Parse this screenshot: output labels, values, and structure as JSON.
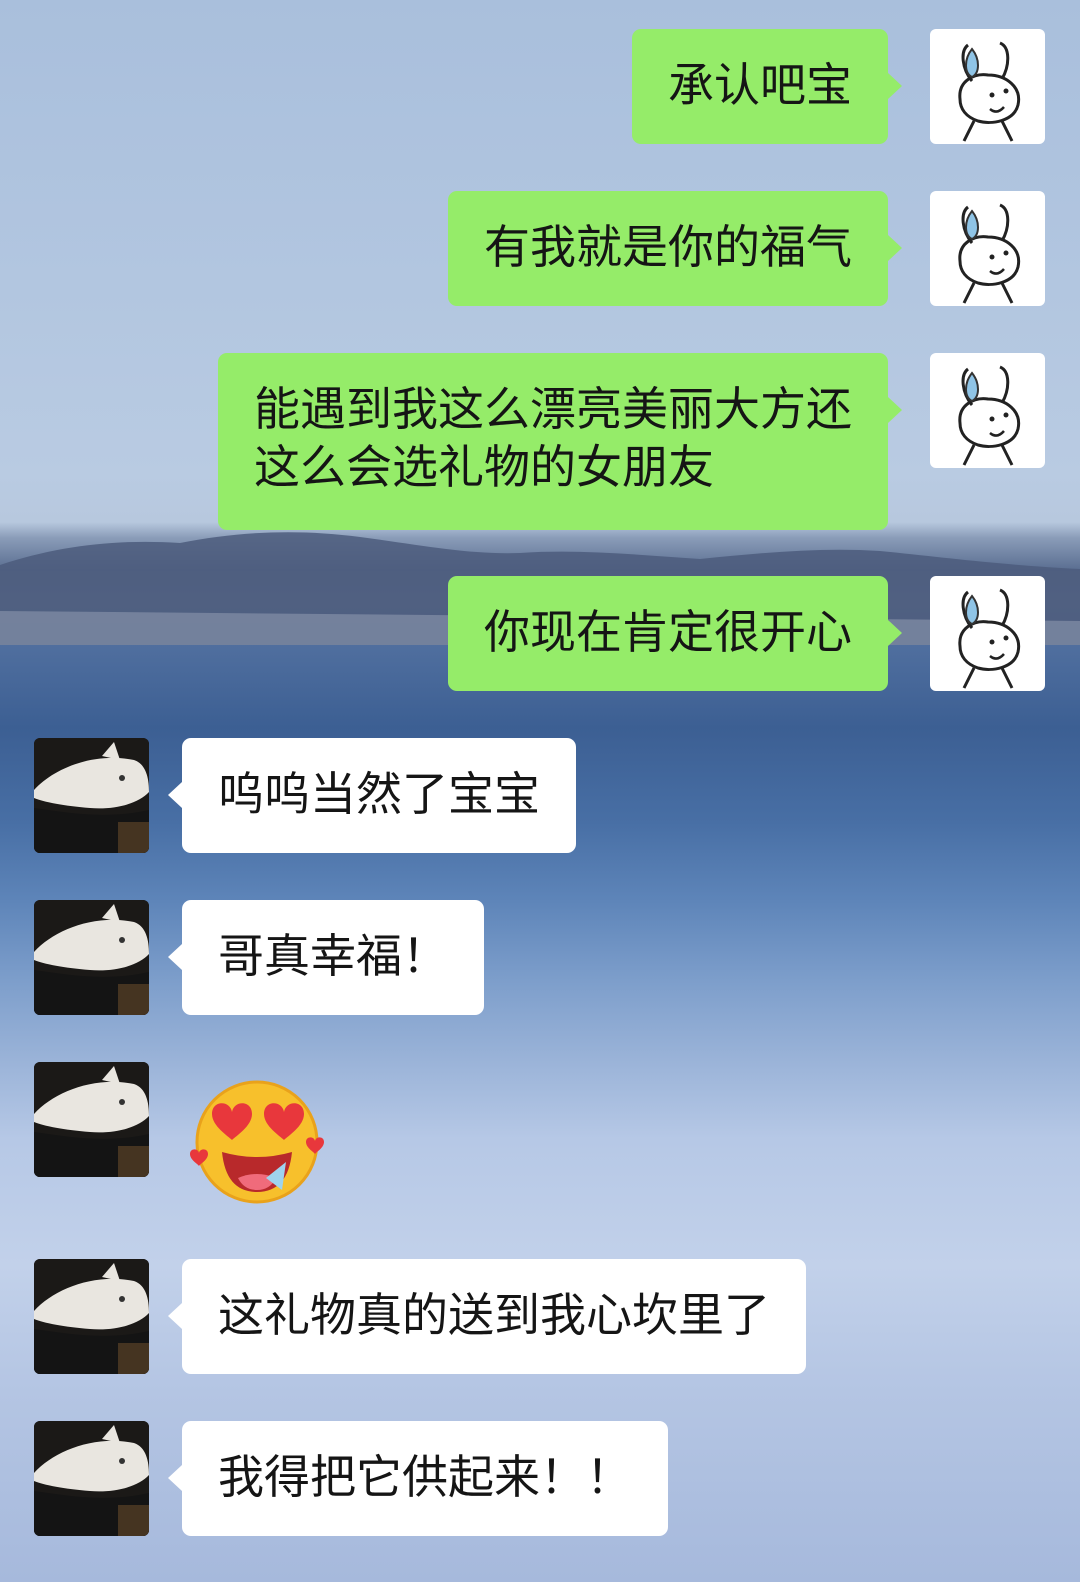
{
  "chat": {
    "messages": [
      {
        "sender": "me",
        "text": "承认吧宝"
      },
      {
        "sender": "me",
        "text": "有我就是你的福气"
      },
      {
        "sender": "me",
        "lines": [
          "能遇到我这么漂亮美丽大方还",
          "这么会选礼物的女朋友"
        ]
      },
      {
        "sender": "me",
        "text": "你现在肯定很开心"
      },
      {
        "sender": "friend",
        "text": "呜呜当然了宝宝"
      },
      {
        "sender": "friend",
        "text": "哥真幸福！"
      },
      {
        "sender": "friend",
        "sticker": "heart-eyes-emoji"
      },
      {
        "sender": "friend",
        "text": "这礼物真的送到我心坎里了"
      },
      {
        "sender": "friend",
        "text": "我得把它供起来！！"
      }
    ]
  },
  "avatars": {
    "me": "bunny-sticker-avatar",
    "friend": "white-cat-avatar"
  },
  "colors": {
    "outgoing_bubble": "#95ec69",
    "incoming_bubble": "#ffffff"
  }
}
